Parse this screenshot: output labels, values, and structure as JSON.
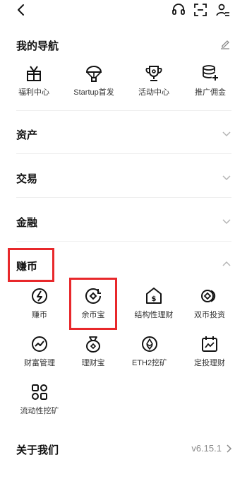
{
  "nav": {
    "title": "我的导航",
    "items": [
      {
        "label": "福利中心",
        "icon": "gift-icon"
      },
      {
        "label": "Startup首发",
        "icon": "parachute-icon"
      },
      {
        "label": "活动中心",
        "icon": "trophy-icon"
      },
      {
        "label": "推广佣金",
        "icon": "coins-add-icon"
      }
    ]
  },
  "sections": {
    "assets": "资产",
    "trade": "交易",
    "finance": "金融",
    "earn": "赚币"
  },
  "earn_items": [
    {
      "label": "赚币",
      "icon": "earn-coin-icon"
    },
    {
      "label": "余币宝",
      "icon": "savings-icon"
    },
    {
      "label": "结构性理财",
      "icon": "structured-product-icon"
    },
    {
      "label": "双币投资",
      "icon": "dual-investment-icon"
    },
    {
      "label": "财富管理",
      "icon": "wealth-chart-icon"
    },
    {
      "label": "理财宝",
      "icon": "money-bag-icon"
    },
    {
      "label": "ETH2挖矿",
      "icon": "ethereum-icon"
    },
    {
      "label": "定投理财",
      "icon": "recurring-buy-icon"
    },
    {
      "label": "流动性挖矿",
      "icon": "liquidity-mining-icon"
    }
  ],
  "about": {
    "label": "关于我们",
    "version": "v6.15.1"
  },
  "colors": {
    "highlight": "#e8282b",
    "text": "#121212",
    "muted": "#8a8a8a"
  }
}
